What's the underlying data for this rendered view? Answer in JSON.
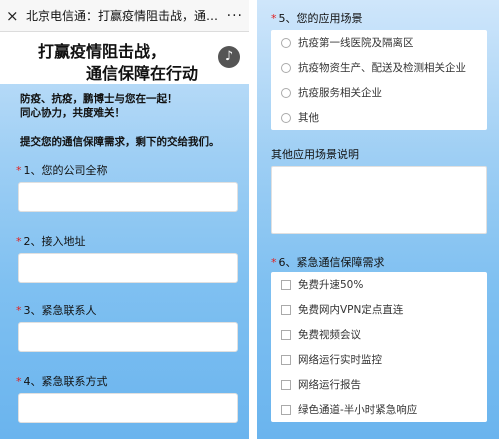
{
  "left": {
    "topbar": {
      "close_glyph": "×",
      "title": "北京电信通：打赢疫情阻击战，通信保...",
      "more_glyph": "···"
    },
    "banner": {
      "line1": "打赢疫情阻击战，",
      "line2": "通信保障在行动",
      "music_icon": "music-note-icon"
    },
    "slogan": [
      "防疫、抗疫，鹏博士与您在一起！",
      "同心协力，共度难关！"
    ],
    "intro": "提交您的通信保障需求，剩下的交给我们。",
    "questions": [
      {
        "star": "*",
        "label": "1、您的公司全称"
      },
      {
        "star": "*",
        "label": "2、接入地址"
      },
      {
        "star": "*",
        "label": "3、紧急联系人"
      },
      {
        "star": "*",
        "label": "4、紧急联系方式"
      }
    ]
  },
  "right": {
    "q5": {
      "star": "*",
      "label": "5、您的应用场景",
      "options": [
        "抗疫第一线医院及隔离区",
        "抗疫物资生产、配送及检测相关企业",
        "抗疫服务相关企业",
        "其他"
      ]
    },
    "other_label": "其他应用场景说明",
    "q6": {
      "star": "*",
      "label": "6、紧急通信保障需求",
      "options": [
        "免费升速50%",
        "免费网内VPN定点直连",
        "免费视频会议",
        "网络运行实时监控",
        "网络运行报告",
        "绿色通道-半小时紧急响应"
      ]
    }
  },
  "colors": {
    "star": "#e02020",
    "bg_top": "#cfe6fb",
    "bg_bottom": "#6ab4ee"
  }
}
